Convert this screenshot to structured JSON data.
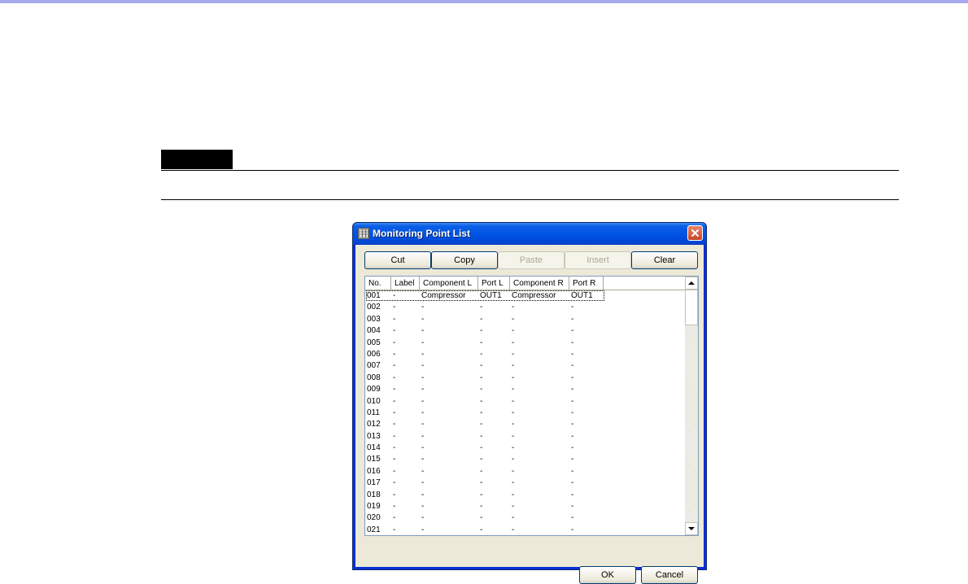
{
  "dialog": {
    "title": "Monitoring Point List",
    "toolbar": [
      {
        "label": "Cut",
        "disabled": false
      },
      {
        "label": "Copy",
        "disabled": false
      },
      {
        "label": "Paste",
        "disabled": true
      },
      {
        "label": "Insert",
        "disabled": true
      },
      {
        "label": "Clear",
        "disabled": false
      }
    ],
    "columns": [
      "No.",
      "Label",
      "Component L",
      "Port L",
      "Component R",
      "Port R"
    ],
    "rows": [
      [
        "001",
        "-",
        "Compressor",
        "OUT1",
        "Compressor",
        "OUT1"
      ],
      [
        "002",
        "-",
        "-",
        "-",
        "-",
        "-"
      ],
      [
        "003",
        "-",
        "-",
        "-",
        "-",
        "-"
      ],
      [
        "004",
        "-",
        "-",
        "-",
        "-",
        "-"
      ],
      [
        "005",
        "-",
        "-",
        "-",
        "-",
        "-"
      ],
      [
        "006",
        "-",
        "-",
        "-",
        "-",
        "-"
      ],
      [
        "007",
        "-",
        "-",
        "-",
        "-",
        "-"
      ],
      [
        "008",
        "-",
        "-",
        "-",
        "-",
        "-"
      ],
      [
        "009",
        "-",
        "-",
        "-",
        "-",
        "-"
      ],
      [
        "010",
        "-",
        "-",
        "-",
        "-",
        "-"
      ],
      [
        "011",
        "-",
        "-",
        "-",
        "-",
        "-"
      ],
      [
        "012",
        "-",
        "-",
        "-",
        "-",
        "-"
      ],
      [
        "013",
        "-",
        "-",
        "-",
        "-",
        "-"
      ],
      [
        "014",
        "-",
        "-",
        "-",
        "-",
        "-"
      ],
      [
        "015",
        "-",
        "-",
        "-",
        "-",
        "-"
      ],
      [
        "016",
        "-",
        "-",
        "-",
        "-",
        "-"
      ],
      [
        "017",
        "-",
        "-",
        "-",
        "-",
        "-"
      ],
      [
        "018",
        "-",
        "-",
        "-",
        "-",
        "-"
      ],
      [
        "019",
        "-",
        "-",
        "-",
        "-",
        "-"
      ],
      [
        "020",
        "-",
        "-",
        "-",
        "-",
        "-"
      ],
      [
        "021",
        "-",
        "-",
        "-",
        "-",
        "-"
      ]
    ],
    "ok_label": "OK",
    "cancel_label": "Cancel"
  },
  "icons": {
    "app": "list-icon",
    "close": "close-icon",
    "scroll_up": "arrow-up-icon",
    "scroll_down": "arrow-down-icon"
  },
  "colors": {
    "titlebar": "#0054e3",
    "close_button": "#c8452a",
    "dialog_face": "#ece9d8",
    "top_rule": "#a9a9ee"
  }
}
